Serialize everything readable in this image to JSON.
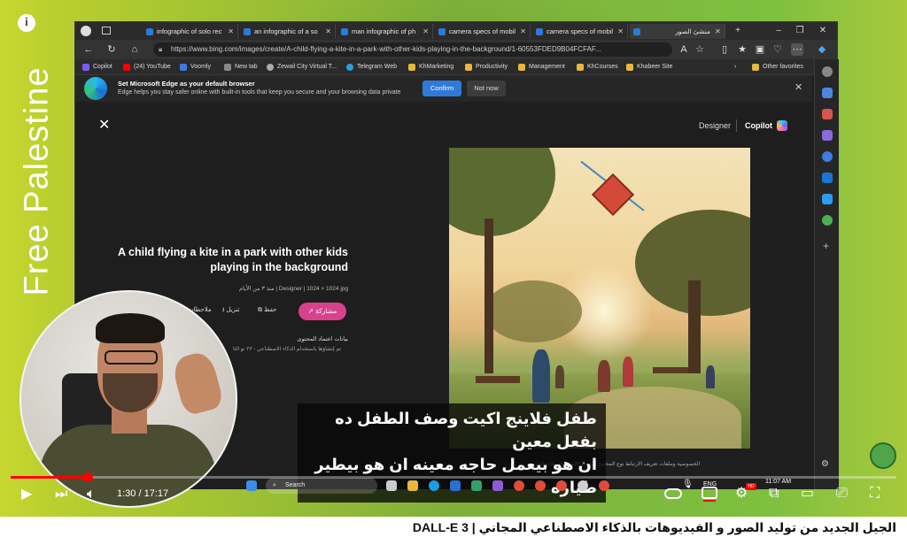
{
  "overlay": {
    "info_icon_label": "i",
    "channel_text": "Free Palestine"
  },
  "browser": {
    "tabs": [
      {
        "label": "infographic of solo rec"
      },
      {
        "label": "an infographic of a so"
      },
      {
        "label": "man infographic of ph"
      },
      {
        "label": "camera specs of mobil"
      },
      {
        "label": "camera specs of mobil"
      },
      {
        "label": "منشئ الصور"
      }
    ],
    "address": "https://www.bing.com/images/create/A-child-flying-a-kite-in-a-park-with-other-kids-playing-in-the-background/1-60553FDED9B04FCFAF...",
    "favorites": [
      {
        "label": "Copilot"
      },
      {
        "label": "(24) YouTube"
      },
      {
        "label": "Voomly"
      },
      {
        "label": "New tab"
      },
      {
        "label": "Zewail City Virtual T..."
      },
      {
        "label": "Telegram Web"
      },
      {
        "label": "KhMarketing"
      },
      {
        "label": "Productivity"
      },
      {
        "label": "Management"
      },
      {
        "label": "KhCourses"
      },
      {
        "label": "Khabeer Site"
      },
      {
        "label": "Other favorites"
      }
    ],
    "notice": {
      "title": "Set Microsoft Edge as your default browser",
      "text": "Edge helps you stay safer online with built-in tools that keep you secure and your browsing data private",
      "confirm": "Confirm",
      "not_now": "Not now"
    }
  },
  "designer": {
    "brand_designer": "Designer",
    "brand_copilot": "Copilot",
    "image_title": "A child flying a kite in a park with other kids playing in the background",
    "meta": "منذ ٣ من الأيام | Designer | 1024 × 1024 jpg",
    "actions": {
      "share": "مشاركة",
      "save": "حفظ",
      "download": "تنزيل",
      "notes": "ملاحظات"
    },
    "credentials_title": "بيانات اعتماد المحتوى",
    "credentials_sub": "تم إنشاؤها باستخدام الذكاء الاصطناعي - ٢٣ نو الثا",
    "footer_links": "الخصوصية وملفات تعريف الارتباط     نوع المحتوى     شروط الاستخدام     ملاحظات"
  },
  "subtitles": {
    "line1": "طفل فلاينج اكيت وصف الطفل ده بفعل معين",
    "line2": "ان هو بيعمل حاجه معينه ان هو بيطير طياره"
  },
  "taskbar": {
    "search": "Search",
    "lang": "ENG",
    "time": "11:07 AM"
  },
  "player": {
    "current_time": "1:30",
    "duration": "17:17",
    "time_display": "1:30 / 17:17",
    "progress_fraction": 0.0868,
    "hd_label": "HD",
    "accent_color": "#ff0000"
  },
  "video_title": "الجيل الجديد من توليد الصور و الفيديوهات بالذكاء الاصطناعي المجاني | DALL-E 3"
}
